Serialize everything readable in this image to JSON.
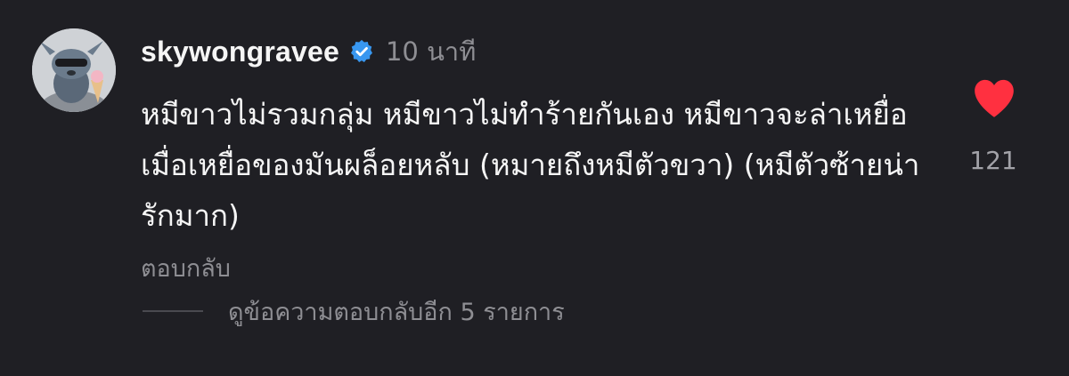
{
  "comment": {
    "username": "skywongravee",
    "verified": true,
    "time": "10 นาที",
    "text": "หมีขาวไม่รวมกลุ่ม หมีขาวไม่ทำร้ายกันเอง หมีขาวจะล่าเหยื่อ เมื่อเหยื่อของมันผล็อยหลับ (หมายถึงหมีตัวขวา) (หมีตัวซ้ายน่ารักมาก)",
    "reply_label": "ตอบกลับ",
    "view_replies_label": "ดูข้อความตอบกลับอีก 5 รายการ",
    "like_count": "121",
    "liked": true
  },
  "icons": {
    "verified": "verified-badge-icon",
    "like": "heart-icon",
    "avatar": "avatar-image"
  },
  "colors": {
    "background": "#1f1f24",
    "text_primary": "#f5f5f5",
    "text_secondary": "#8e8e93",
    "verified_blue": "#3897f0",
    "like_red": "#ff3040"
  }
}
